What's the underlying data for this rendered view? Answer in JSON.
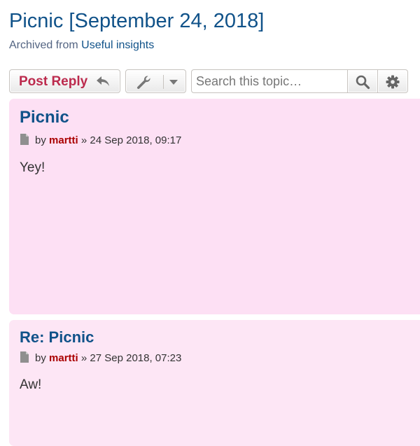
{
  "page": {
    "topic_title": "Picnic",
    "date_open": "[",
    "date_text": "September 24, 2018",
    "date_close": "]",
    "archived_prefix": "Archived from",
    "archived_link": "Useful insights"
  },
  "toolbar": {
    "reply_label": "Post Reply",
    "search_placeholder": "Search this topic…"
  },
  "posts": [
    {
      "title": "Picnic",
      "by": "by",
      "author": "martti",
      "sep": "»",
      "datetime": "24 Sep 2018, 09:17",
      "content": "Yey!",
      "background": "#fde0f4"
    },
    {
      "title": "Re: Picnic",
      "by": "by",
      "author": "martti",
      "sep": "»",
      "datetime": "27 Sep 2018, 07:23",
      "content": "Aw!",
      "background": "#fde6f5"
    }
  ],
  "colors": {
    "link": "#105289",
    "reply": "#bc2a4d",
    "author": "#aa0000"
  },
  "icons": [
    "reply-icon",
    "wrench-icon",
    "caret-down-icon",
    "search-icon",
    "gear-icon",
    "document-icon"
  ]
}
